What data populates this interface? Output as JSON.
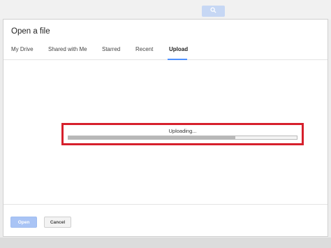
{
  "dialog": {
    "title": "Open a file",
    "tabs": [
      {
        "label": "My Drive",
        "active": false
      },
      {
        "label": "Shared with Me",
        "active": false
      },
      {
        "label": "Starred",
        "active": false
      },
      {
        "label": "Recent",
        "active": false
      },
      {
        "label": "Upload",
        "active": true
      }
    ],
    "upload": {
      "status_text": "Uploading...",
      "progress_fraction": 0.73
    },
    "buttons": {
      "open_label": "Open",
      "cancel_label": "Cancel"
    }
  },
  "background": {
    "search_icon": "search-icon"
  },
  "colors": {
    "accent": "#4d90fe",
    "highlight_border": "#d6202c",
    "open_button": "#a9c4f5"
  }
}
